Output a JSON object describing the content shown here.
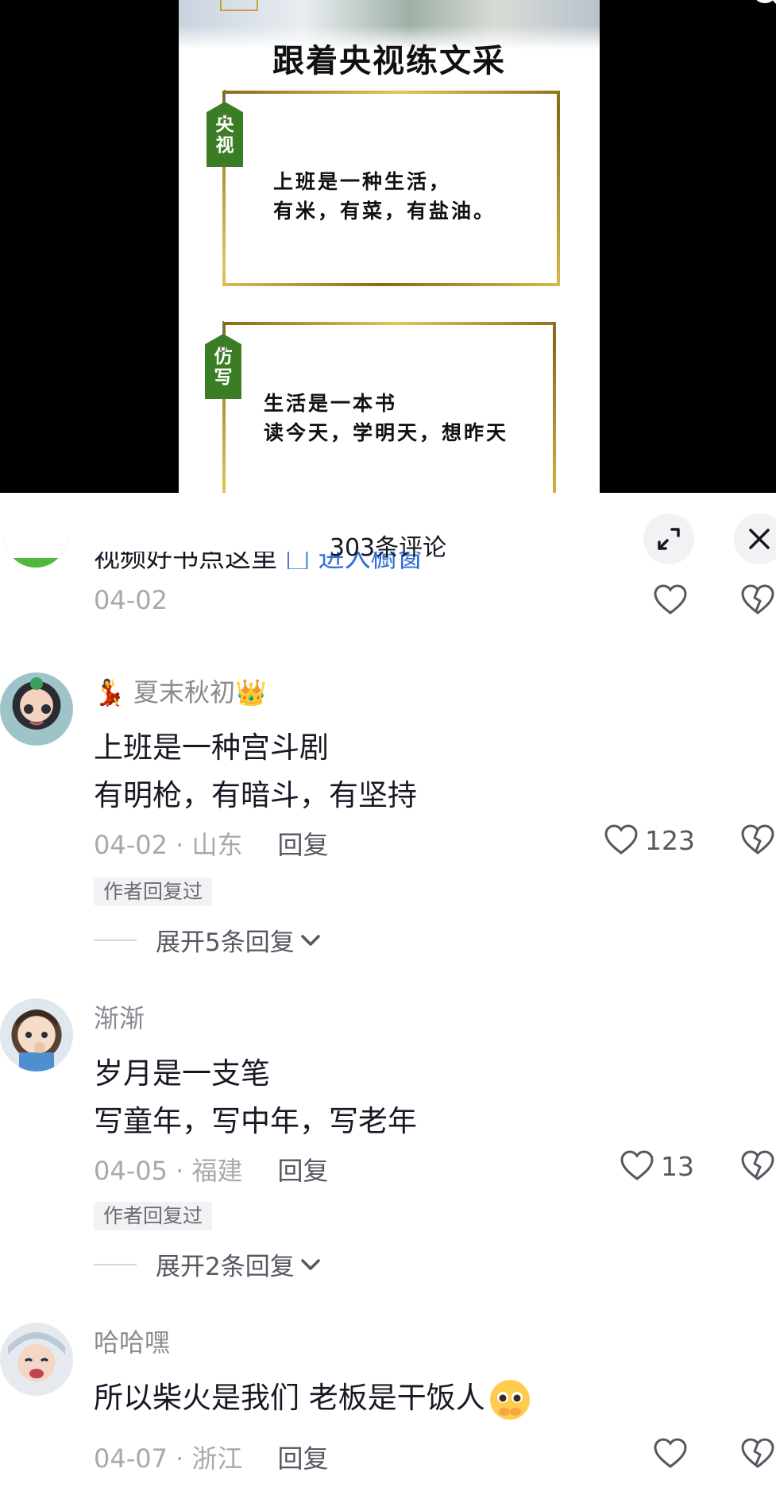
{
  "video": {
    "title": "跟着央视练文采",
    "cards": [
      {
        "tag": "央视",
        "lines": [
          "上班是一种生活，",
          "有米，有菜，有盐油。"
        ]
      },
      {
        "tag": "仿写",
        "lines": [
          "生活是一本书",
          "读今天，学明天，想昨天"
        ]
      }
    ]
  },
  "comments_panel": {
    "title": "303条评论",
    "partial_comment": {
      "text": "视频好书点这里",
      "link": "进入橱窗",
      "date": "04-02"
    },
    "comments": [
      {
        "username": "夏末秋初",
        "lines": [
          "上班是一种宫斗剧",
          "有明枪，有暗斗，有坚持"
        ],
        "date": "04-02 · 山东",
        "reply_label": "回复",
        "likes": "123",
        "author_badge": "作者回复过",
        "expand_label": "展开5条回复"
      },
      {
        "username": "渐渐",
        "lines": [
          "岁月是一支笔",
          "写童年，写中年，写老年"
        ],
        "date": "04-05 · 福建",
        "reply_label": "回复",
        "likes": "13",
        "author_badge": "作者回复过",
        "expand_label": "展开2条回复"
      },
      {
        "username": "哈哈嘿",
        "lines": [
          "所以柴火是我们 老板是干饭人"
        ],
        "date": "04-07 · 浙江",
        "reply_label": "回复"
      }
    ]
  },
  "icons": {
    "like": "heart-outline-icon",
    "dislike": "broken-heart-icon",
    "expand": "expand-icon",
    "close": "close-icon",
    "chevron": "chevron-down-icon"
  }
}
